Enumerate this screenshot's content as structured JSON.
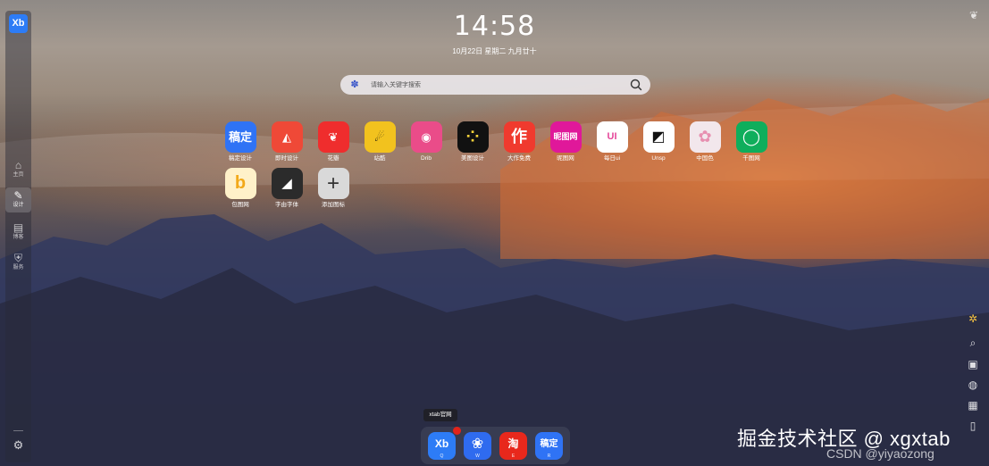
{
  "sidebar": {
    "logo": "Xb",
    "items": [
      {
        "label": "主页",
        "icon": "home-icon",
        "glyph": "⌂"
      },
      {
        "label": "设计",
        "icon": "design-icon",
        "glyph": "✎"
      },
      {
        "label": "博客",
        "icon": "document-icon",
        "glyph": "▤"
      },
      {
        "label": "服务",
        "icon": "shield-icon",
        "glyph": "⛨"
      }
    ],
    "settings_glyph": "⚙"
  },
  "clock": {
    "time": "14:58",
    "date": "10月22日 星期二 九月廿十"
  },
  "search": {
    "placeholder": "请输入关键字搜索",
    "value": "",
    "engine_glyph": "✽"
  },
  "apps": [
    {
      "name": "稿定设计",
      "text": "稿定",
      "color": "#2f73f5"
    },
    {
      "name": "即时设计",
      "text": "◭",
      "color": "#ef4937"
    },
    {
      "name": "花瓣",
      "text": "❦",
      "color": "#ef2d2d"
    },
    {
      "name": "站酷",
      "text": "☄",
      "color": "#f2c21e"
    },
    {
      "name": "Drib",
      "text": "◉",
      "color": "#ea4c89"
    },
    {
      "name": "美图设计",
      "text": "⁘",
      "color": "#111111"
    },
    {
      "name": "大作免费",
      "text": "作",
      "color": "#f03a2e"
    },
    {
      "name": "昵图网",
      "text": "昵图网",
      "color": "#e0189a"
    },
    {
      "name": "每日ui",
      "text": "UI",
      "color": "#ffffff"
    },
    {
      "name": "Unsp",
      "text": "◩",
      "color": "#ffffff"
    },
    {
      "name": "中国色",
      "text": "✿",
      "color": "#f2e7ec"
    },
    {
      "name": "千图网",
      "text": "◯",
      "color": "#0fae5c"
    },
    {
      "name": "包图网",
      "text": "b",
      "color": "#fff1c9"
    },
    {
      "name": "字由字体",
      "text": "◢",
      "color": "#2b2b2b"
    },
    {
      "name": "添加图标",
      "text": "+",
      "color": "#d9d9d9"
    }
  ],
  "right_tools": [
    {
      "icon": "pinwheel-icon",
      "glyph": "✲"
    },
    {
      "icon": "search-icon",
      "glyph": "⌕"
    },
    {
      "icon": "image-icon",
      "glyph": "▣"
    },
    {
      "icon": "theme-icon",
      "glyph": "◍"
    },
    {
      "icon": "grid-icon",
      "glyph": "▦"
    },
    {
      "icon": "bag-icon",
      "glyph": "▯"
    }
  ],
  "dock": {
    "tooltip": "xtab官网",
    "apps": [
      {
        "text": "Xb",
        "key": "Q",
        "color": "#2d7cf6"
      },
      {
        "text": "❀",
        "key": "W",
        "color": "#2f6bef"
      },
      {
        "text": "淘",
        "key": "E",
        "color": "#e8281c"
      },
      {
        "text": "稿定",
        "key": "R",
        "color": "#2f73f5"
      }
    ]
  },
  "watermark": {
    "primary": "掘金技术社区 @ xgxtab",
    "secondary": "CSDN @yiyaozong"
  }
}
